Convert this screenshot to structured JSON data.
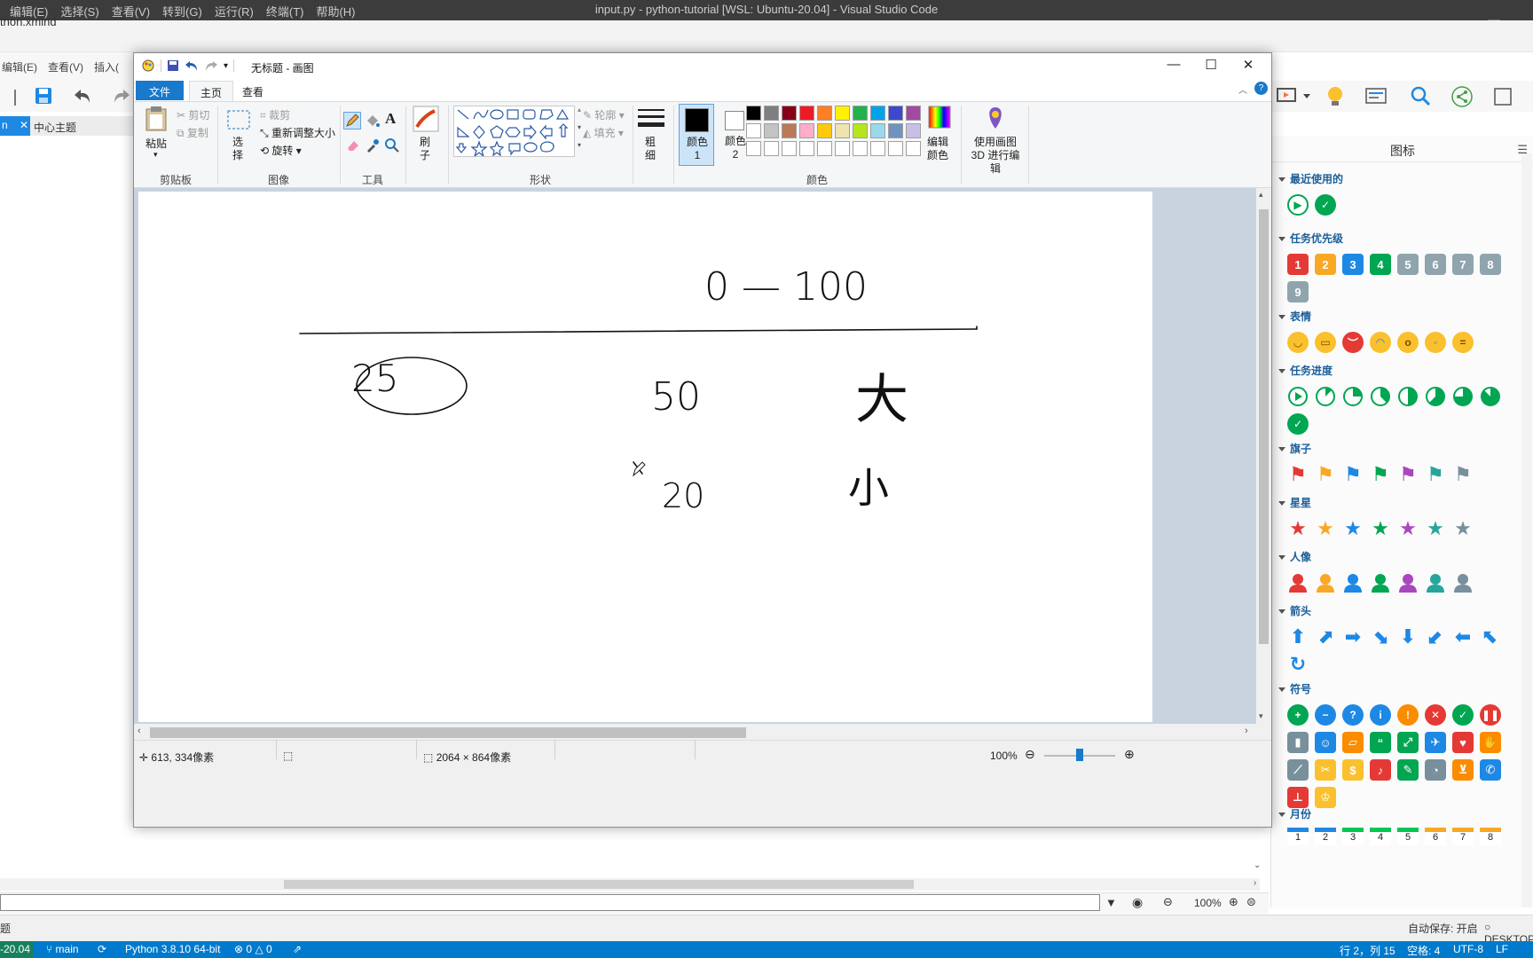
{
  "vscode": {
    "menu": [
      "编辑(E)",
      "选择(S)",
      "查看(V)",
      "转到(G)",
      "运行(R)",
      "终端(T)",
      "帮助(H)"
    ],
    "title": "input.py - python-tutorial [WSL: Ubuntu-20.04] - Visual Studio Code",
    "status": {
      "remote": "-20.04",
      "branch": "main",
      "python": "Python 3.8.10 64-bit",
      "problems": "0",
      "warnings": "0",
      "position": "行 2，列 15",
      "spaces": "空格: 4",
      "encoding": "UTF-8",
      "eol": "LF"
    }
  },
  "xmind": {
    "title": "thon.xmind",
    "menu": [
      "编辑(E)",
      "查看(V)",
      "插入("
    ],
    "tab_active": "n",
    "tab_other": "中心主题",
    "panel": {
      "title": "图标",
      "sections": {
        "recent": "最近使用的",
        "priority": "任务优先级",
        "emotion": "表情",
        "progress": "任务进度",
        "flag": "旗子",
        "star": "星星",
        "people": "人像",
        "arrow": "箭头",
        "symbol": "符号",
        "month": "月份"
      },
      "priority_numbers": [
        "1",
        "2",
        "3",
        "4",
        "5",
        "6",
        "7",
        "8",
        "9"
      ],
      "month_numbers": [
        "1",
        "2",
        "3",
        "4",
        "5",
        "6",
        "7",
        "8"
      ]
    },
    "zoom": "100%",
    "status_left": "题",
    "autosave": "自动保存: 开启",
    "desktop": "DESKTOP",
    "colors": {
      "priority": [
        "#e53935",
        "#f9a825",
        "#1e88e5",
        "#00a651",
        "#90a4ae",
        "#90a4ae",
        "#90a4ae",
        "#90a4ae",
        "#90a4ae"
      ],
      "flags": [
        "#e53935",
        "#f9a825",
        "#1e88e5",
        "#00a651",
        "#ab47bc",
        "#26a69a",
        "#78909c"
      ],
      "month": [
        "#1e88e5",
        "#1e88e5",
        "#00c853",
        "#00c853",
        "#00c853",
        "#f9a825",
        "#f9a825",
        "#f9a825"
      ]
    }
  },
  "paint": {
    "title": "无标题 - 画图",
    "tabs": {
      "file": "文件",
      "home": "主页",
      "view": "查看"
    },
    "clipboard": {
      "paste": "粘贴",
      "cut": "剪切",
      "copy": "复制",
      "label": "剪贴板"
    },
    "image": {
      "select": "选择",
      "crop": "裁剪",
      "resize": "重新调整大小",
      "rotate": "旋转",
      "label": "图像"
    },
    "tools": {
      "label": "工具"
    },
    "brush": {
      "label": "刷子"
    },
    "shapes": {
      "outline": "轮廓",
      "fill": "填充",
      "label": "形状"
    },
    "size": {
      "label": "粗细"
    },
    "colors": {
      "color1": "颜色 1",
      "color2": "颜色 2",
      "edit": "编辑颜色",
      "paint3d": "使用画图 3D 进行编辑",
      "label": "颜色",
      "palette_row1": [
        "#000000",
        "#7f7f7f",
        "#880015",
        "#ed1c24",
        "#ff7f27",
        "#fff200",
        "#22b14c",
        "#00a2e8",
        "#3f48cc",
        "#a349a4"
      ],
      "palette_row2": [
        "#ffffff",
        "#c3c3c3",
        "#b97a57",
        "#ffaec9",
        "#ffc90e",
        "#efe4b0",
        "#b5e61d",
        "#99d9ea",
        "#7092be",
        "#c8bfe7"
      ]
    },
    "status": {
      "cursor": "613, 334像素",
      "size": "2064 × 864像素",
      "zoom": "100%"
    },
    "drawing": {
      "range": "0 — 100",
      "circled": "25",
      "middle_top": "50",
      "middle_bottom": "20",
      "right_top": "大",
      "right_bottom": "小"
    }
  }
}
